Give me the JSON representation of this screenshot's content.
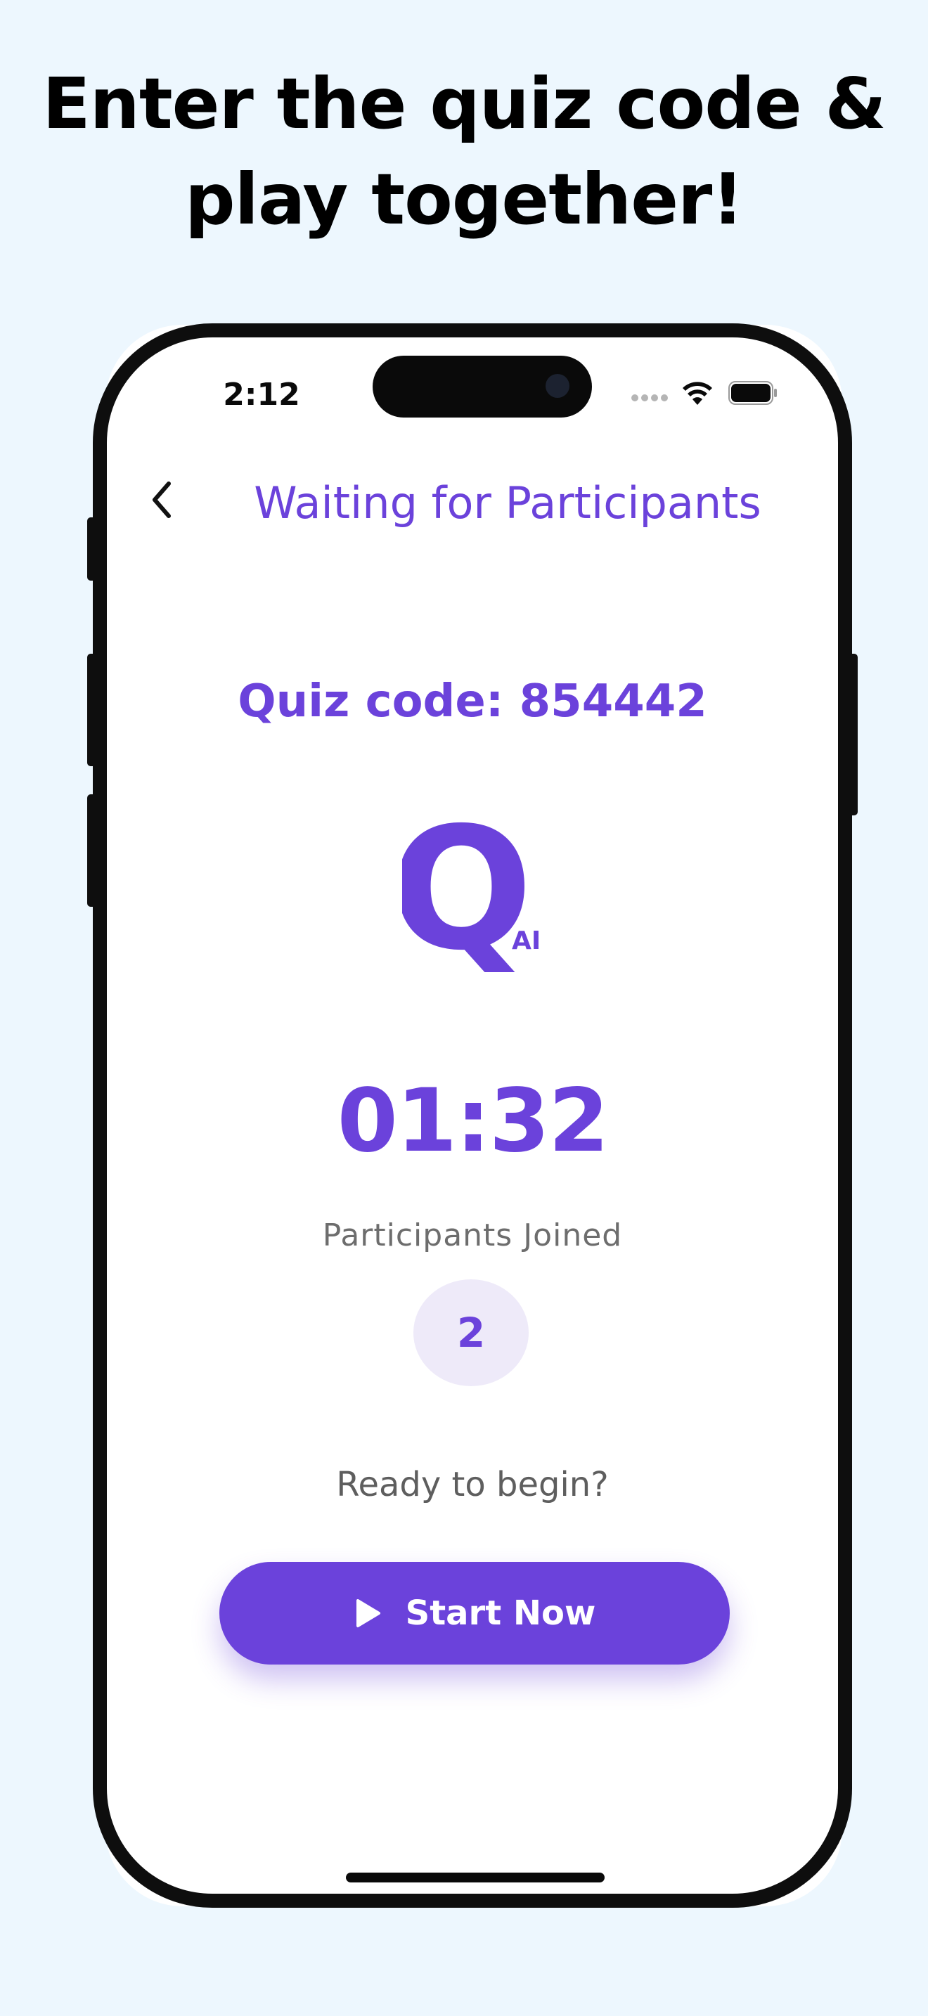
{
  "headline": {
    "line1": "Enter the quiz code &",
    "line2": "play together!"
  },
  "status_bar": {
    "time": "2:12",
    "icons": [
      "signal-icon",
      "wifi-icon",
      "battery-icon"
    ]
  },
  "nav": {
    "back_icon": "chevron-left-icon",
    "title": "Waiting for Participants"
  },
  "quiz": {
    "code_text": "Quiz code: 854442",
    "logo_letter": "Q",
    "logo_sub": "AI",
    "timer": "01:32",
    "participants_label": "Participants Joined",
    "participants_count": "2",
    "ready_text": "Ready to begin?",
    "start_label": "Start Now",
    "start_icon": "play-icon"
  },
  "colors": {
    "accent": "#6B42DB",
    "page_background": "#EDF7FE",
    "badge_background": "#EEEAF9",
    "frame": "#0E0E0E"
  }
}
